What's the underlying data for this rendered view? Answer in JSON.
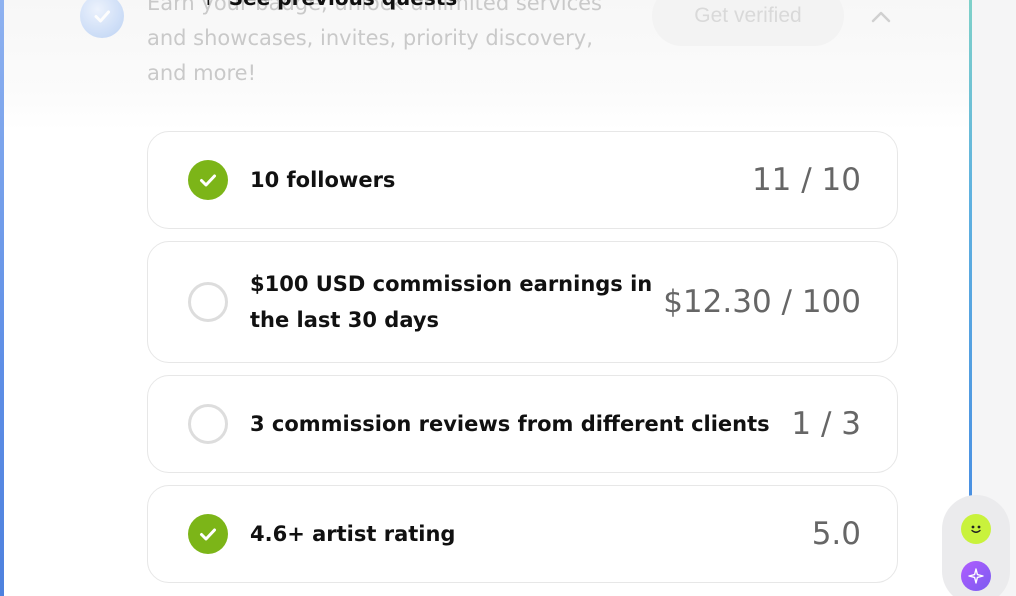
{
  "header": {
    "description": "Earn your badge, unlock unlimited services and showcases, invites, priority discovery, and more!",
    "previous_quests_label": "See previous quests",
    "previous_quests_caret": "↑",
    "verify_button_label": "Get verified"
  },
  "quests": [
    {
      "label": "10 followers",
      "progress": "11 / 10",
      "completed": true
    },
    {
      "label": "$100 USD commission earnings in the last 30 days",
      "progress": "$12.30 / 100",
      "completed": false
    },
    {
      "label": "3 commission reviews from different clients",
      "progress": "1 / 3",
      "completed": false
    },
    {
      "label": "4.6+ artist rating",
      "progress": "5.0",
      "completed": true
    }
  ],
  "colors": {
    "complete": "#7cb518",
    "incomplete_ring": "#dddddd",
    "accent_blue": "#4a90e2"
  },
  "widget": {
    "buttons": [
      "face-icon",
      "sparkle-icon"
    ]
  }
}
